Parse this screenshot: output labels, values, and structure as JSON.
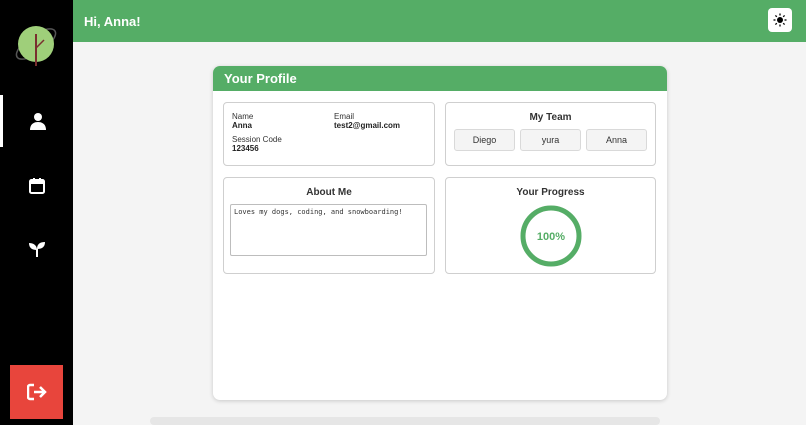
{
  "header": {
    "greeting": "Hi, Anna!"
  },
  "sidebar": {
    "items": [
      {
        "name": "profile",
        "icon": "user-icon",
        "active": true
      },
      {
        "name": "calendar",
        "icon": "calendar-icon",
        "active": false
      },
      {
        "name": "growth",
        "icon": "sprout-icon",
        "active": false
      }
    ],
    "logout_icon": "logout-icon"
  },
  "profile": {
    "title": "Your Profile",
    "info": {
      "name_label": "Name",
      "name_value": "Anna",
      "email_label": "Email",
      "email_value": "test2@gmail.com",
      "session_label": "Session Code",
      "session_value": "123456"
    },
    "team": {
      "title": "My Team",
      "members": [
        "Diego",
        "yura",
        "Anna"
      ]
    },
    "about": {
      "title": "About Me",
      "text": "Loves my dogs, coding, and snowboarding!"
    },
    "progress": {
      "title": "Your Progress",
      "label": "100%",
      "value": 1.0
    }
  },
  "colors": {
    "accent": "#55ad66",
    "logout": "#e8453c",
    "sidebar": "#000000"
  }
}
